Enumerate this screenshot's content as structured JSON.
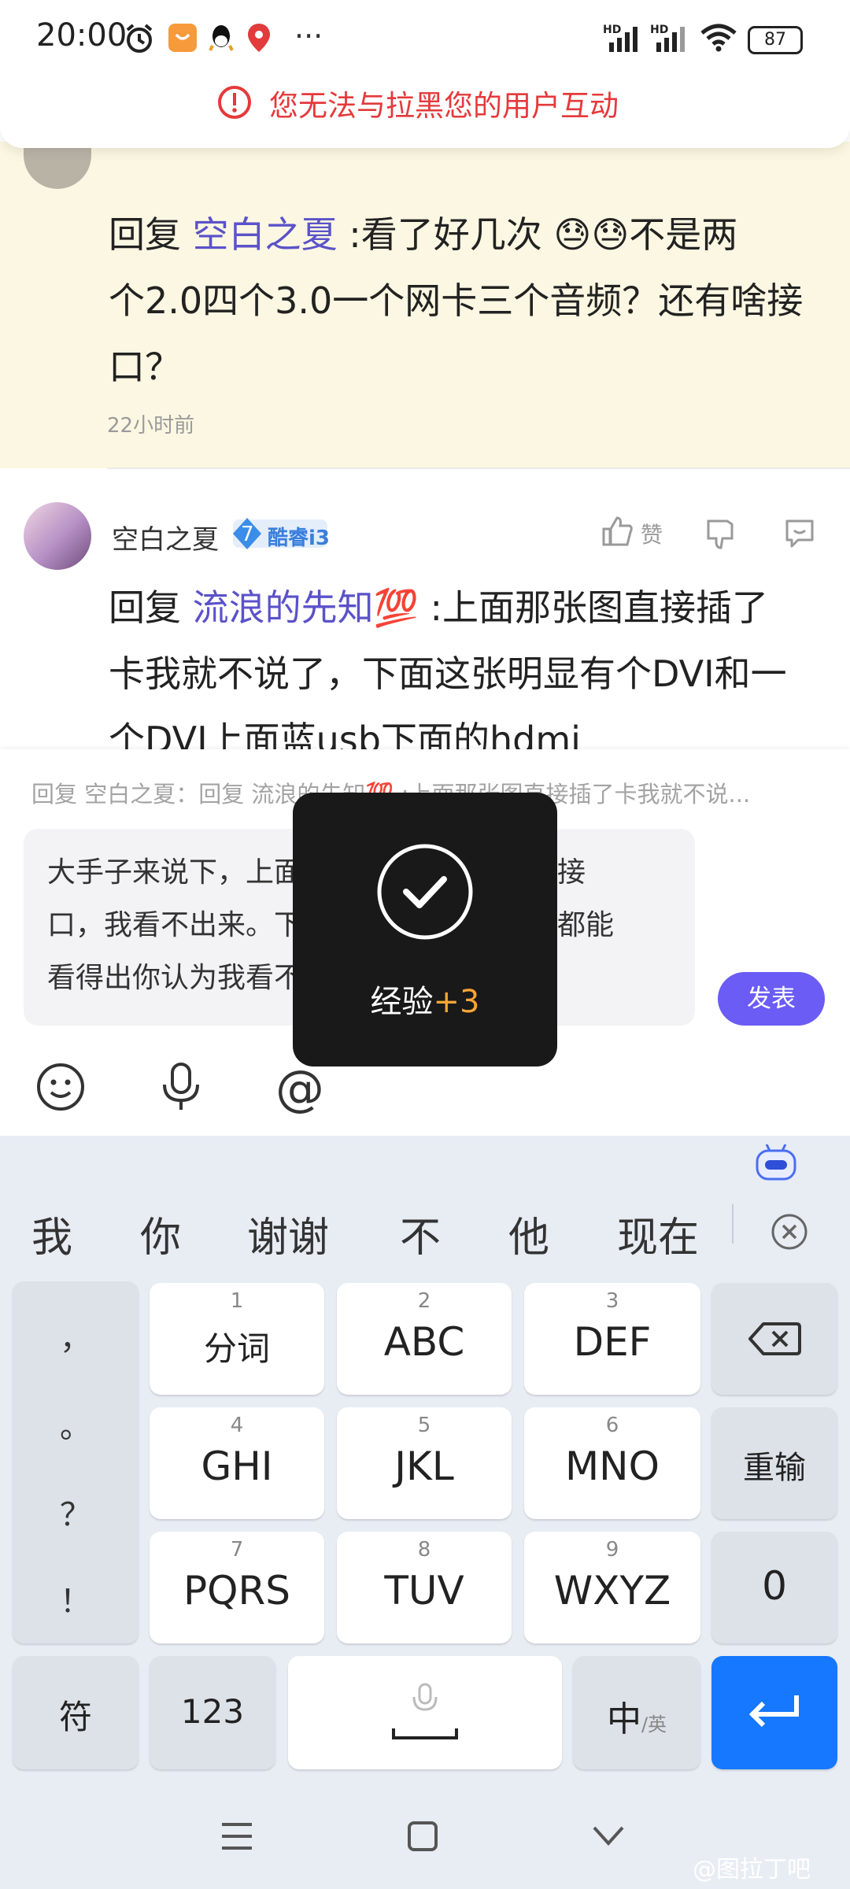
{
  "status_bar": {
    "time": "20:00",
    "signal1": "HD",
    "signal2": "HD",
    "battery": "87",
    "more": "···"
  },
  "notice": {
    "text": "您无法与拉黑您的用户互动"
  },
  "comments": [
    {
      "reply_prefix": "回复",
      "mention": "空白之夏",
      "body_line1": ":看了好几次",
      "body_line1b": "不是两",
      "body_line2": "个2.0四个3.0一个网卡三个音频？还有啥接",
      "body_line3": "口？",
      "time": "22小时前"
    },
    {
      "username": "空白之夏",
      "level": "7",
      "badge": "酷睿i3",
      "like_label": "赞",
      "reply_prefix": "回复",
      "mention": "流浪的先知💯",
      "body_line1": ":上面那张图直接插了",
      "body_line2": "卡我就不说了，下面这张明显有个DVI和一",
      "body_line3": "个DVI上面蓝usb下面的hdmi"
    }
  ],
  "composer": {
    "quote": "回复 空白之夏：回复 流浪的先知💯 :上面那张图直接插了卡我就不说...",
    "text_line1": "大手子来说下，上面那个主板的视频输出接",
    "text_line2": "口，我看不出来。下面那个这么明显瞎子都能",
    "text_line3": "看得出你认为我看不出？笑死还拉黑我。",
    "post_label": "发表"
  },
  "toast": {
    "label": "经验",
    "plus": "+3"
  },
  "keyboard": {
    "candidates": [
      "我",
      "你",
      "谢谢",
      "不",
      "他",
      "现在"
    ],
    "punct": [
      "，",
      "。",
      "？",
      "！"
    ],
    "keys": [
      {
        "num": "1",
        "label": "分词"
      },
      {
        "num": "2",
        "label": "ABC"
      },
      {
        "num": "3",
        "label": "DEF"
      },
      {
        "num": "4",
        "label": "GHI"
      },
      {
        "num": "5",
        "label": "JKL"
      },
      {
        "num": "6",
        "label": "MNO"
      },
      {
        "num": "7",
        "label": "PQRS"
      },
      {
        "num": "8",
        "label": "TUV"
      },
      {
        "num": "9",
        "label": "WXYZ"
      }
    ],
    "reinput": "重输",
    "zero": "0",
    "symbols": "符",
    "num123": "123",
    "lang_main": "中",
    "lang_alt": "/英"
  },
  "watermark": "@图拉丁吧"
}
